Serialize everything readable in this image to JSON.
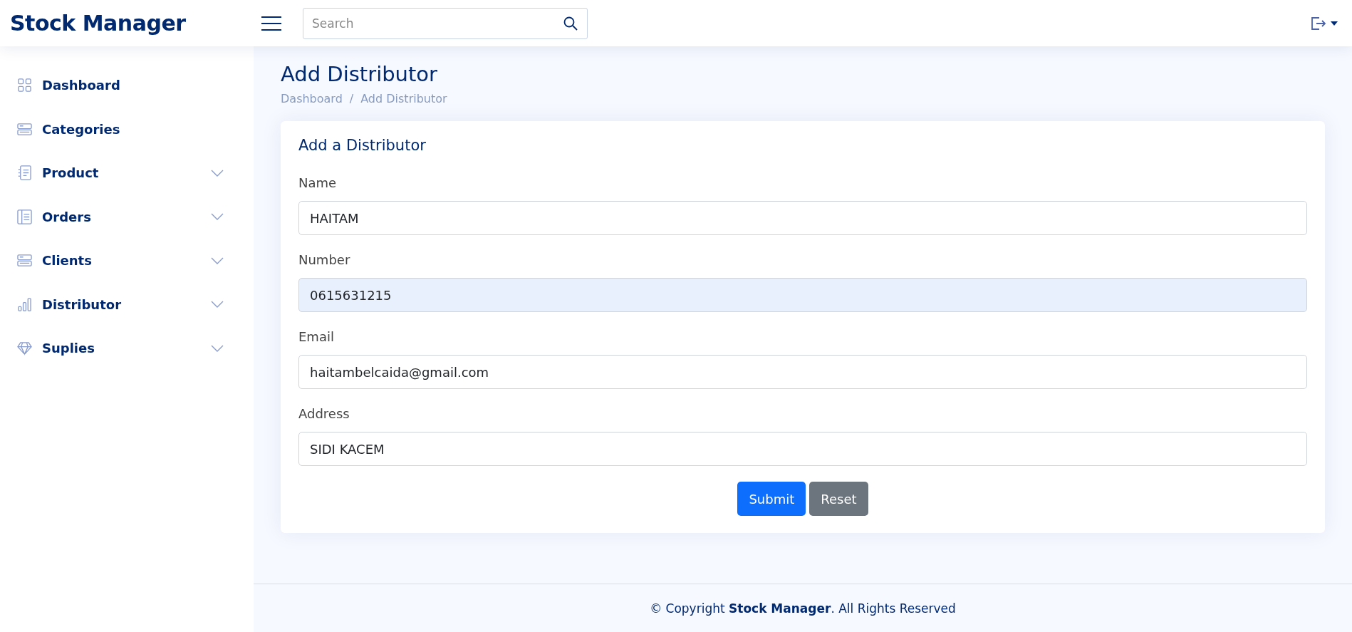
{
  "header": {
    "brand": "Stock Manager",
    "search": {
      "placeholder": "Search"
    }
  },
  "sidebar": {
    "items": [
      {
        "label": "Dashboard",
        "kind": "link"
      },
      {
        "label": "Categories",
        "kind": "link"
      },
      {
        "label": "Product",
        "kind": "dropdown",
        "expanded": false
      },
      {
        "label": "Orders",
        "kind": "dropdown",
        "expanded": false
      },
      {
        "label": "Clients",
        "kind": "dropdown",
        "expanded": false
      },
      {
        "label": "Distributor",
        "kind": "dropdown",
        "expanded": false
      },
      {
        "label": "Suplies",
        "kind": "dropdown",
        "expanded": false
      }
    ]
  },
  "page": {
    "title": "Add Distributor",
    "breadcrumb": [
      "Dashboard",
      "Add Distributor"
    ],
    "breadcrumb_separator": "/"
  },
  "card": {
    "title": "Add a Distributor",
    "fields": [
      {
        "label": "Name",
        "value": "HAITAM",
        "autofilled": false
      },
      {
        "label": "Number",
        "value": "0615631215",
        "autofilled": true
      },
      {
        "label": "Email",
        "value": "haitambelcaida@gmail.com",
        "autofilled": false
      },
      {
        "label": "Address",
        "value": "SIDI KACEM",
        "autofilled": false
      }
    ],
    "buttons": [
      {
        "label": "Submit",
        "kind": "primary"
      },
      {
        "label": "Reset",
        "kind": "secondary"
      }
    ]
  },
  "footer": {
    "text": "© Copyright **Stock Manager**. All Rights Reserved"
  }
}
